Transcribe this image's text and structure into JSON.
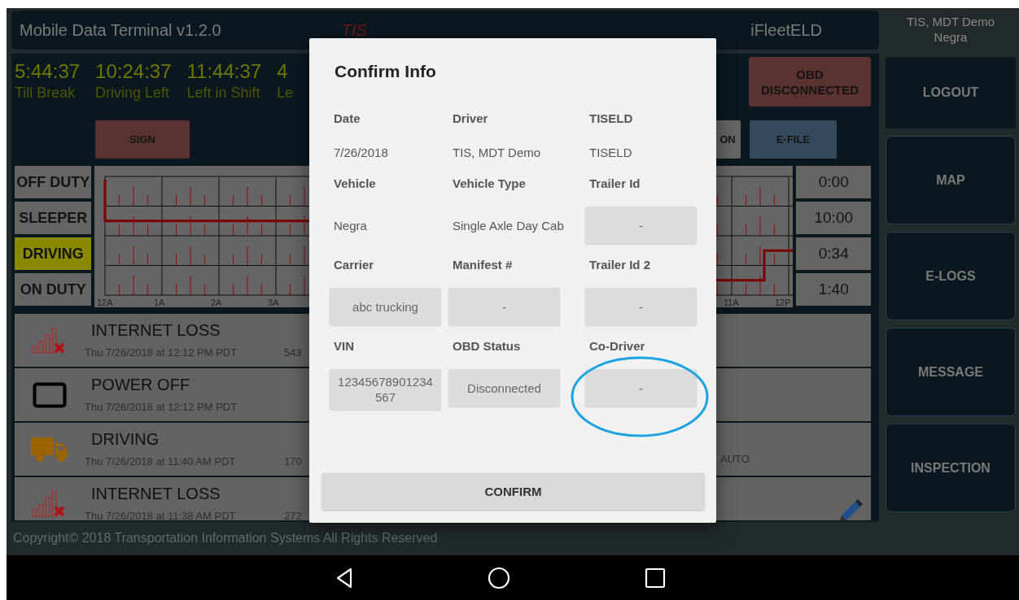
{
  "app_bar": {
    "title": "Mobile Data Terminal v1.2.0",
    "brand": "TIS",
    "product": "iFleetELD"
  },
  "user": {
    "driver": "TIS, MDT Demo",
    "vehicle": "Negra"
  },
  "timers": [
    {
      "value": "5:44:37",
      "label": "Till Break"
    },
    {
      "value": "10:24:37",
      "label": "Driving Left"
    },
    {
      "value": "11:44:37",
      "label": "Left in Shift"
    },
    {
      "value": "4",
      "label": "Le"
    }
  ],
  "alert": "OBD DISCONNECTED",
  "actions": [
    {
      "label": "SIGN",
      "kind": "sign"
    },
    {
      "label": "ON",
      "kind": "plain"
    },
    {
      "label": "E-FILE",
      "kind": "efile"
    }
  ],
  "duty_statuses": [
    {
      "label": "OFF DUTY",
      "selected": false,
      "total": "0:00"
    },
    {
      "label": "SLEEPER",
      "selected": false,
      "total": "10:00"
    },
    {
      "label": "DRIVING",
      "selected": true,
      "total": "0:34"
    },
    {
      "label": "ON DUTY",
      "selected": false,
      "total": "1:40"
    }
  ],
  "graph": {
    "hour_labels_left": [
      "12A",
      "1A",
      "2A",
      "3A"
    ],
    "hour_labels_right": [
      "11A",
      "12P"
    ]
  },
  "events": [
    {
      "kind": "signal-loss",
      "title": "INTERNET LOSS",
      "time": "Thu 7/26/2018 at 12:12 PM PDT",
      "code": "543"
    },
    {
      "kind": "power-off",
      "title": "POWER OFF",
      "time": "Thu 7/26/2018 at 12:12 PM PDT"
    },
    {
      "kind": "driving",
      "title": "DRIVING",
      "time": "Thu 7/26/2018 at 11:40 AM PDT",
      "code": "170",
      "source": "AUTO"
    },
    {
      "kind": "signal-loss",
      "title": "INTERNET LOSS",
      "time": "Thu 7/26/2018 at 11:38 AM PDT",
      "code": "272",
      "editable": true
    }
  ],
  "footer": "Copyright© 2018 Transportation Information Systems All Rights Reserved",
  "sidebar": [
    "LOGOUT",
    "MAP",
    "E-LOGS",
    "MESSAGE",
    "INSPECTION"
  ],
  "dialog": {
    "title": "Confirm Info",
    "rows": [
      [
        {
          "label": "Date",
          "value": "7/26/2018",
          "kind": "text"
        },
        {
          "label": "Driver",
          "value": "TIS, MDT Demo",
          "kind": "text"
        },
        {
          "label": "TISELD",
          "value": "TISELD",
          "kind": "text"
        }
      ],
      [
        {
          "label": "Vehicle",
          "value": "Negra",
          "kind": "text"
        },
        {
          "label": "Vehicle Type",
          "value": "Single Axle Day Cab",
          "kind": "text"
        },
        {
          "label": "Trailer Id",
          "value": "-",
          "kind": "box"
        }
      ],
      [
        {
          "label": "Carrier",
          "value": "abc trucking",
          "kind": "box"
        },
        {
          "label": "Manifest #",
          "value": "-",
          "kind": "box"
        },
        {
          "label": "Trailer Id 2",
          "value": "-",
          "kind": "box"
        }
      ],
      [
        {
          "label": "VIN",
          "value": "12345678901234567",
          "kind": "box"
        },
        {
          "label": "OBD Status",
          "value": "Disconnected",
          "kind": "box"
        },
        {
          "label": "Co-Driver",
          "value": "-",
          "kind": "box",
          "highlighted": true
        }
      ]
    ],
    "confirm": "CONFIRM"
  }
}
